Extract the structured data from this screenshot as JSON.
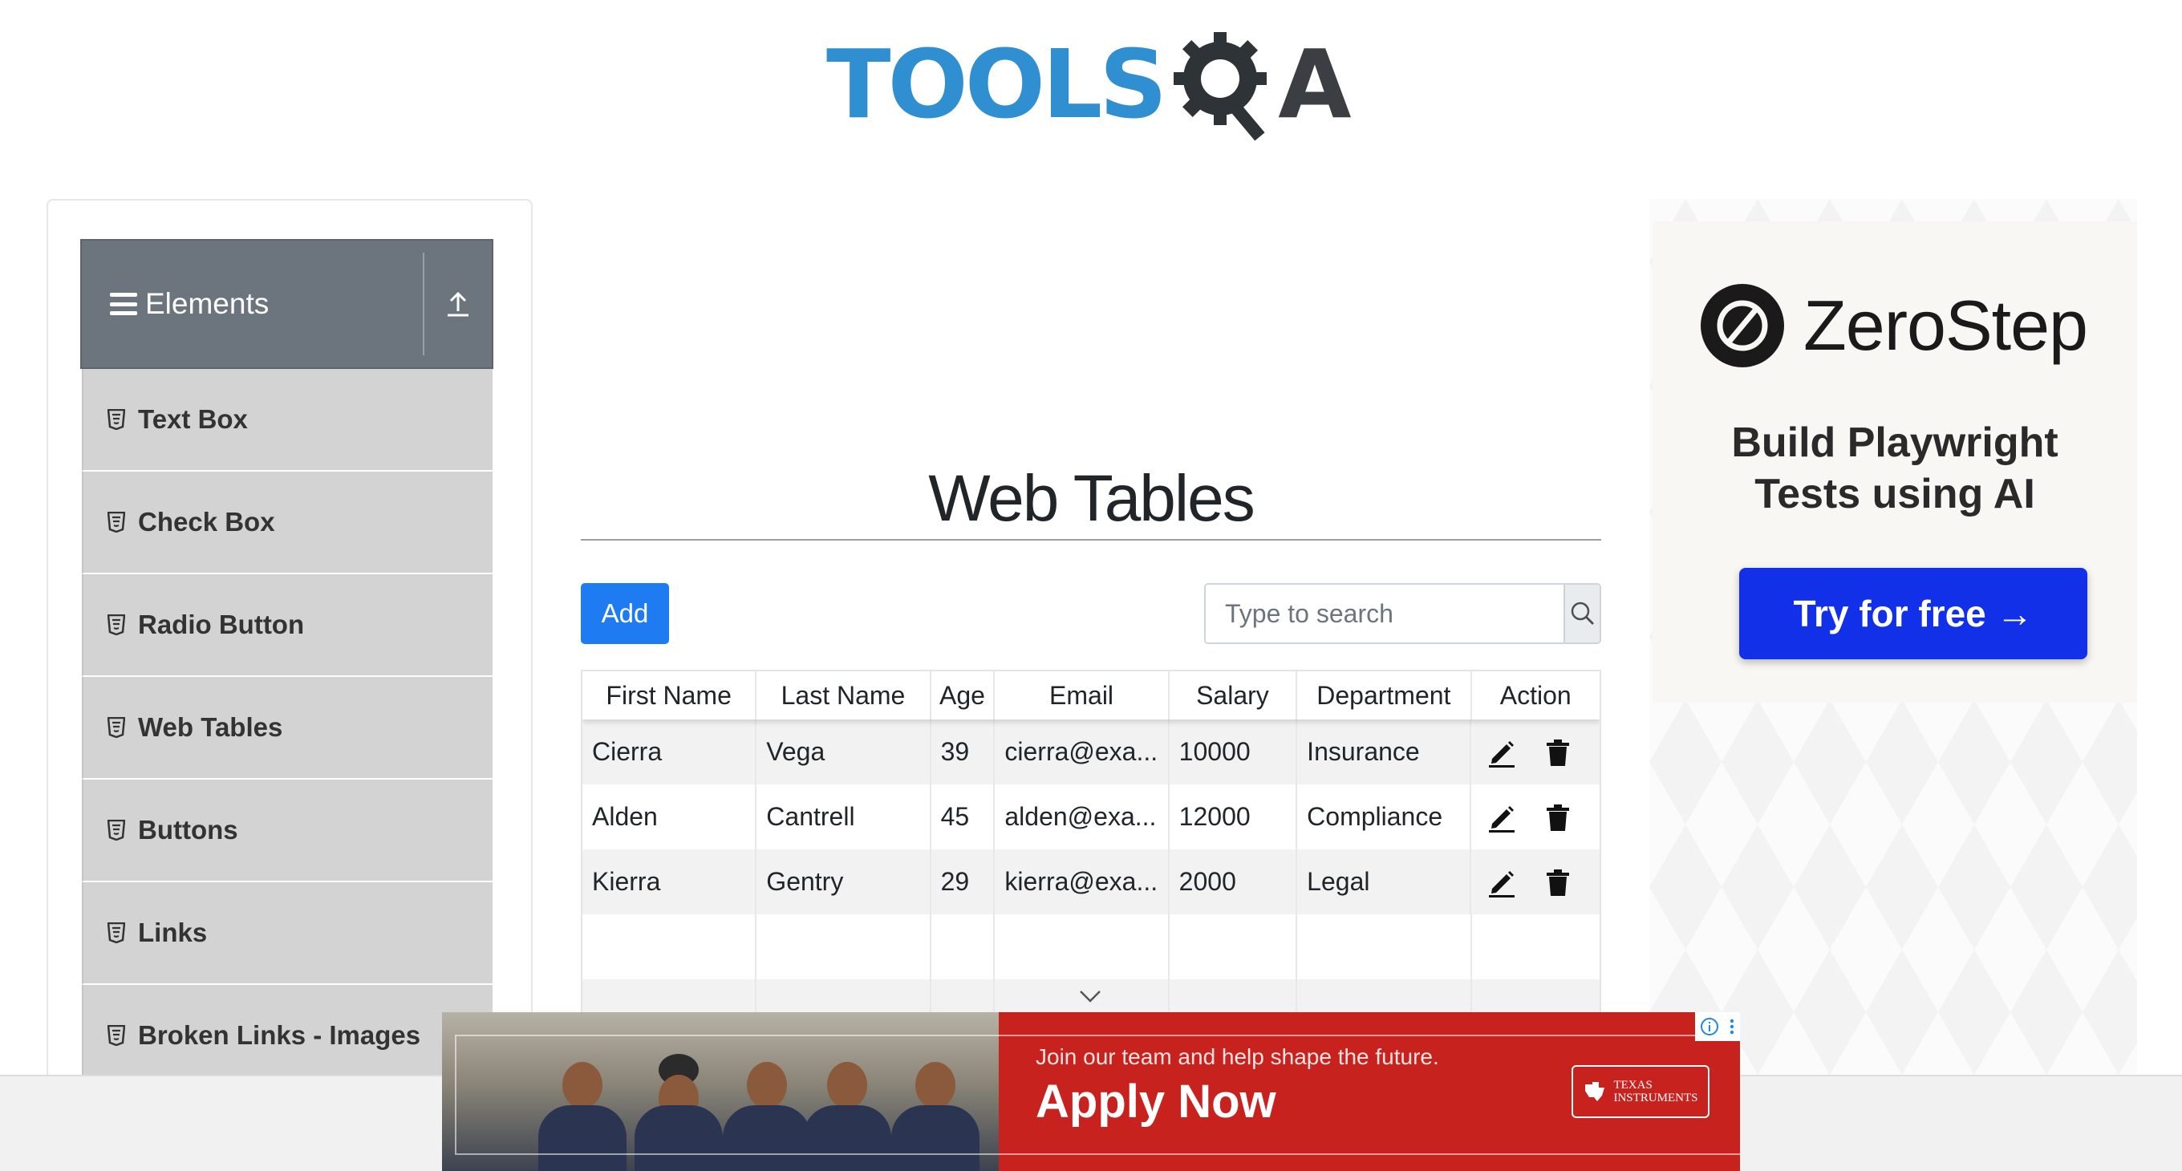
{
  "header": {
    "logo_tools": "TOOLS",
    "logo_a": "A"
  },
  "sidebar": {
    "group_title": "Elements",
    "items": [
      {
        "label": "Text Box"
      },
      {
        "label": "Check Box"
      },
      {
        "label": "Radio Button"
      },
      {
        "label": "Web Tables"
      },
      {
        "label": "Buttons"
      },
      {
        "label": "Links"
      },
      {
        "label": "Broken Links - Images"
      }
    ]
  },
  "main": {
    "title": "Web Tables",
    "add_label": "Add",
    "search_placeholder": "Type to search",
    "columns": [
      "First Name",
      "Last Name",
      "Age",
      "Email",
      "Salary",
      "Department",
      "Action"
    ],
    "rows": [
      {
        "first": "Cierra",
        "last": "Vega",
        "age": "39",
        "email": "cierra@exa...",
        "salary": "10000",
        "department": "Insurance"
      },
      {
        "first": "Alden",
        "last": "Cantrell",
        "age": "45",
        "email": "alden@exa...",
        "salary": "12000",
        "department": "Compliance"
      },
      {
        "first": "Kierra",
        "last": "Gentry",
        "age": "29",
        "email": "kierra@exa...",
        "salary": "2000",
        "department": "Legal"
      }
    ]
  },
  "right_ad": {
    "brand": "ZeroStep",
    "tagline_line1": "Build Playwright",
    "tagline_line2": "Tests using AI",
    "cta": "Try for free →"
  },
  "banner_ad": {
    "subtitle": "Join our team and help shape the future.",
    "cta": "Apply Now",
    "sponsor_line1": "Texas",
    "sponsor_line2": "Instruments"
  },
  "colors": {
    "accent_blue": "#1f7bf2",
    "logo_blue": "#2f8fd1",
    "sidebar_header": "#6c757d",
    "menu_item_bg": "#d3d3d3",
    "zerostep_button": "#1130e8",
    "banner_red": "#c8221f"
  },
  "icons": {
    "menu": "hamburger-icon",
    "collapse": "collapse-up-icon",
    "item": "html5-shield-icon",
    "search": "search-icon",
    "edit": "pencil-icon",
    "delete": "trash-icon"
  }
}
